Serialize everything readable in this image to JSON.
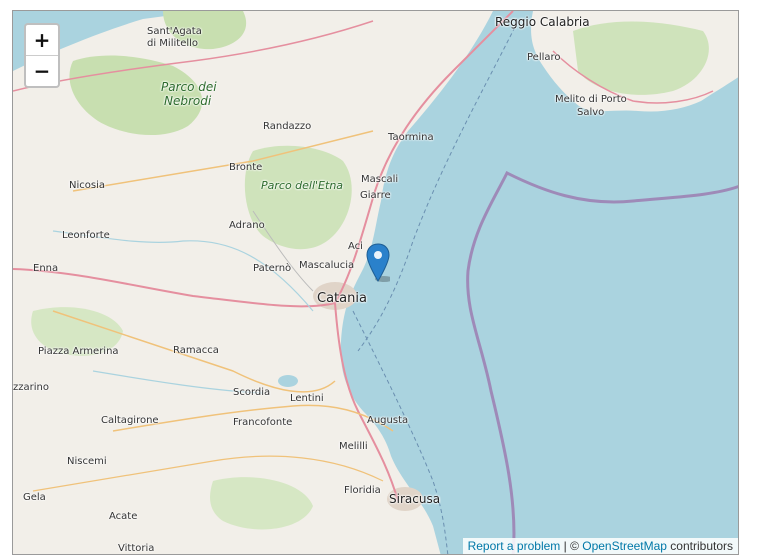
{
  "zoom": {
    "in_label": "+",
    "out_label": "−"
  },
  "attribution": {
    "report_link": "Report a problem",
    "separator": " | © ",
    "osm_link": "OpenStreetMap",
    "suffix": " contributors"
  },
  "labels": {
    "sant_agata": "Sant'Agata",
    "di_militello": "di Militello",
    "parco_dei": "Parco dei",
    "nebrodi": "Nebrodi",
    "randazzo": "Randazzo",
    "bronte": "Bronte",
    "parco_etna": "Parco dell'Etna",
    "nicosia": "Nicosia",
    "adrano": "Adrano",
    "leonforte": "Leonforte",
    "enna": "Enna",
    "paterno": "Paternò",
    "mascalucia": "Mascalucia",
    "acireale": "Aci",
    "catania": "Catania",
    "mascali": "Mascali",
    "giarre": "Giarre",
    "taormina": "Taormina",
    "reggio": "Reggio Calabria",
    "pellaro": "Pellaro",
    "melito": "Melito di Porto",
    "salvo": "Salvo",
    "piazza_armerina": "Piazza Armerina",
    "ramacca": "Ramacca",
    "barrafranca": "zzarino",
    "scordia": "Scordia",
    "lentini": "Lentini",
    "augusta": "Augusta",
    "caltagirone": "Caltagirone",
    "francofonte": "Francofonte",
    "melilli": "Melilli",
    "niscemi": "Niscemi",
    "floridia": "Floridia",
    "siracusa": "Siracusa",
    "gela": "Gela",
    "acate": "Acate",
    "vittoria": "Vittoria"
  },
  "colors": {
    "sea": "#aad3df",
    "land": "#f2efe9",
    "forest": "#c8dfb0",
    "road": "#e58f9f",
    "border": "#9e8ab8",
    "marker": "#2a81cb"
  }
}
